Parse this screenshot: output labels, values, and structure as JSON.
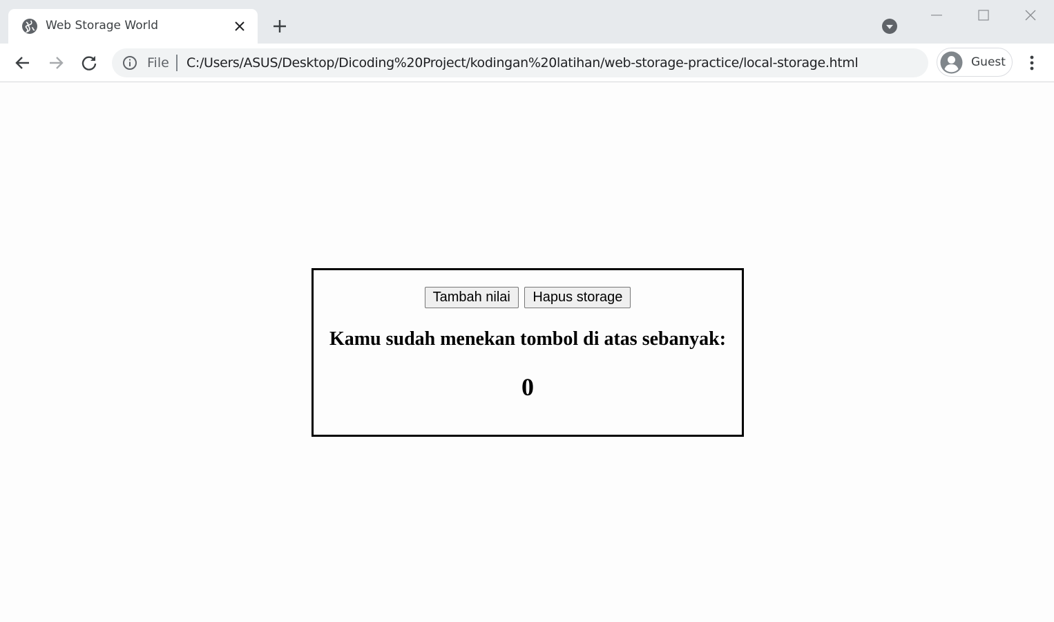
{
  "browser": {
    "tab": {
      "title": "Web Storage World"
    },
    "address_bar": {
      "scheme_label": "File",
      "url": "C:/Users/ASUS/Desktop/Dicoding%20Project/kodingan%20latihan/web-storage-practice/local-storage.html"
    },
    "profile": {
      "label": "Guest"
    }
  },
  "page": {
    "buttons": {
      "add_label": "Tambah nilai",
      "clear_label": "Hapus storage"
    },
    "message": "Kamu sudah menekan tombol di atas sebanyak:",
    "count": "0"
  }
}
